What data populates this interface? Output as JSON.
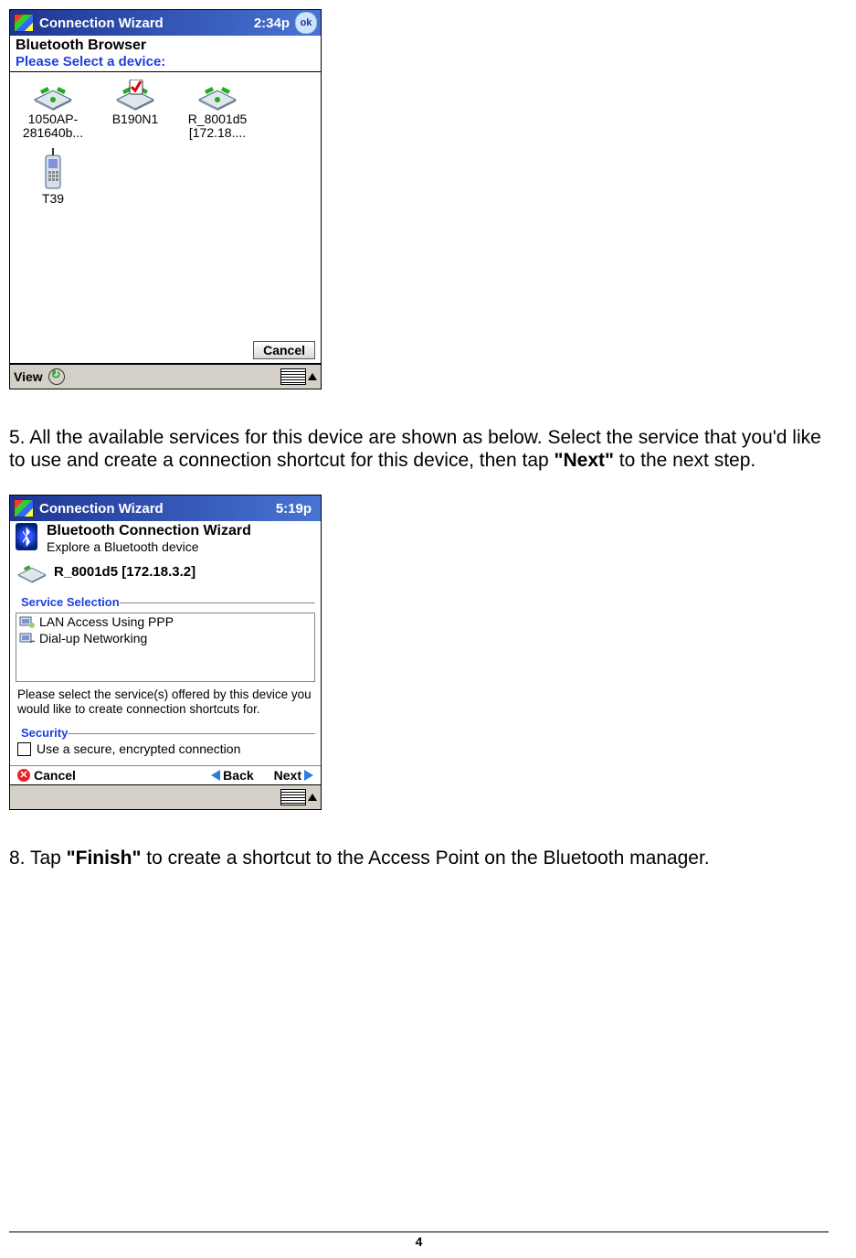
{
  "shot1": {
    "title": "Connection Wizard",
    "time": "2:34p",
    "ok": "ok",
    "heading": "Bluetooth Browser",
    "prompt": "Please Select a device:",
    "devices": [
      {
        "label": "1050AP-281640b...",
        "icon": "router"
      },
      {
        "label": "B190N1",
        "icon": "router-check"
      },
      {
        "label": "R_8001d5 [172.18....",
        "icon": "router"
      },
      {
        "label": "T39",
        "icon": "phone"
      }
    ],
    "cancel": "Cancel",
    "view": "View"
  },
  "step5": {
    "prefix": "5. All the available services for this device are shown as below. Select the service that you'd like to use and create a connection shortcut for this device, then tap ",
    "bold": "\"Next\"",
    "suffix": " to the next step."
  },
  "shot2": {
    "title": "Connection Wizard",
    "time": "5:19p",
    "wiz_title": "Bluetooth Connection Wizard",
    "wiz_sub": "Explore a Bluetooth device",
    "device": "R_8001d5 [172.18.3.2]",
    "svc_title": "Service Selection",
    "services": [
      "LAN Access Using PPP",
      "Dial-up Networking"
    ],
    "svc_hint": "Please select the service(s) offered by this device you would like to create connection shortcuts for.",
    "sec_title": "Security",
    "sec_opt": "Use a secure, encrypted connection",
    "nav": {
      "cancel": "Cancel",
      "back": "Back",
      "next": "Next"
    }
  },
  "step8": {
    "prefix": "8. Tap ",
    "bold": "\"Finish\"",
    "suffix": " to create a shortcut to the Access Point on the Bluetooth manager."
  },
  "page_number": "4"
}
